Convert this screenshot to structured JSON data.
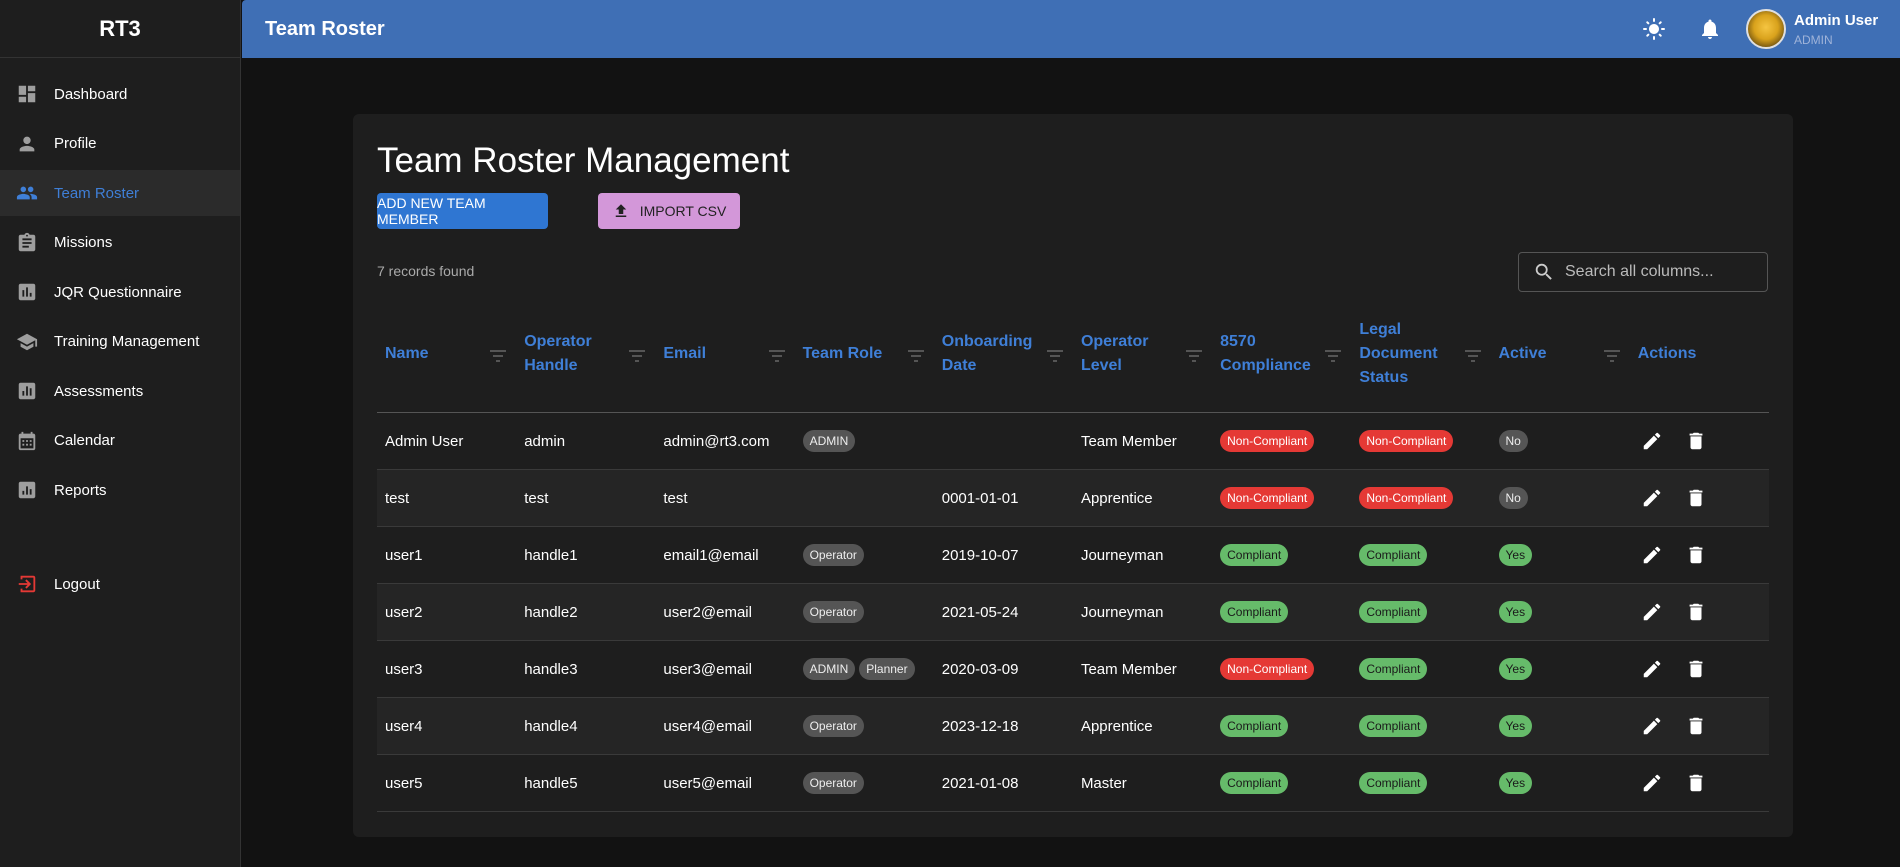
{
  "brand": "RT3",
  "sidebar": {
    "items": [
      {
        "label": "Dashboard",
        "icon": "dashboard-icon"
      },
      {
        "label": "Profile",
        "icon": "person-icon"
      },
      {
        "label": "Team Roster",
        "icon": "people-icon",
        "active": true
      },
      {
        "label": "Missions",
        "icon": "clipboard-icon"
      },
      {
        "label": "JQR Questionnaire",
        "icon": "bar-chart-icon"
      },
      {
        "label": "Training Management",
        "icon": "school-icon"
      },
      {
        "label": "Assessments",
        "icon": "assessment-icon"
      },
      {
        "label": "Calendar",
        "icon": "calendar-icon"
      },
      {
        "label": "Reports",
        "icon": "report-icon"
      }
    ],
    "logout": {
      "label": "Logout",
      "icon": "logout-icon"
    }
  },
  "header": {
    "title": "Team Roster",
    "user_name": "Admin User",
    "user_role": "ADMIN"
  },
  "main": {
    "title": "Team Roster Management",
    "add_button": "ADD NEW TEAM MEMBER",
    "import_button": "IMPORT CSV",
    "records": "7 records found",
    "search_placeholder": "Search all columns..."
  },
  "table": {
    "columns": [
      "Name",
      "Operator Handle",
      "Email",
      "Team Role",
      "Onboarding Date",
      "Operator Level",
      "8570 Compliance",
      "Legal Document Status",
      "Active",
      "Actions"
    ],
    "rows": [
      {
        "name": "Admin User",
        "handle": "admin",
        "email": "admin@rt3.com",
        "roles": [
          "ADMIN"
        ],
        "date": "",
        "level": "Team Member",
        "compliance": "Non-Compliant",
        "legal": "Non-Compliant",
        "active": "No"
      },
      {
        "name": "test",
        "handle": "test",
        "email": "test",
        "roles": [],
        "date": "0001-01-01",
        "level": "Apprentice",
        "compliance": "Non-Compliant",
        "legal": "Non-Compliant",
        "active": "No"
      },
      {
        "name": "user1",
        "handle": "handle1",
        "email": "email1@email",
        "roles": [
          "Operator"
        ],
        "date": "2019-10-07",
        "level": "Journeyman",
        "compliance": "Compliant",
        "legal": "Compliant",
        "active": "Yes"
      },
      {
        "name": "user2",
        "handle": "handle2",
        "email": "user2@email",
        "roles": [
          "Operator"
        ],
        "date": "2021-05-24",
        "level": "Journeyman",
        "compliance": "Compliant",
        "legal": "Compliant",
        "active": "Yes"
      },
      {
        "name": "user3",
        "handle": "handle3",
        "email": "user3@email",
        "roles": [
          "ADMIN",
          "Planner"
        ],
        "date": "2020-03-09",
        "level": "Team Member",
        "compliance": "Non-Compliant",
        "legal": "Compliant",
        "active": "Yes"
      },
      {
        "name": "user4",
        "handle": "handle4",
        "email": "user4@email",
        "roles": [
          "Operator"
        ],
        "date": "2023-12-18",
        "level": "Apprentice",
        "compliance": "Compliant",
        "legal": "Compliant",
        "active": "Yes"
      },
      {
        "name": "user5",
        "handle": "handle5",
        "email": "user5@email",
        "roles": [
          "Operator"
        ],
        "date": "2021-01-08",
        "level": "Master",
        "compliance": "Compliant",
        "legal": "Compliant",
        "active": "Yes"
      }
    ]
  },
  "colors": {
    "header": "#3f6fb5",
    "accent": "#3f7fd7",
    "primary_button": "#2f76d2",
    "import_button": "#d397d9",
    "non_compliant": "#e53935",
    "compliant": "#66bb6a"
  }
}
